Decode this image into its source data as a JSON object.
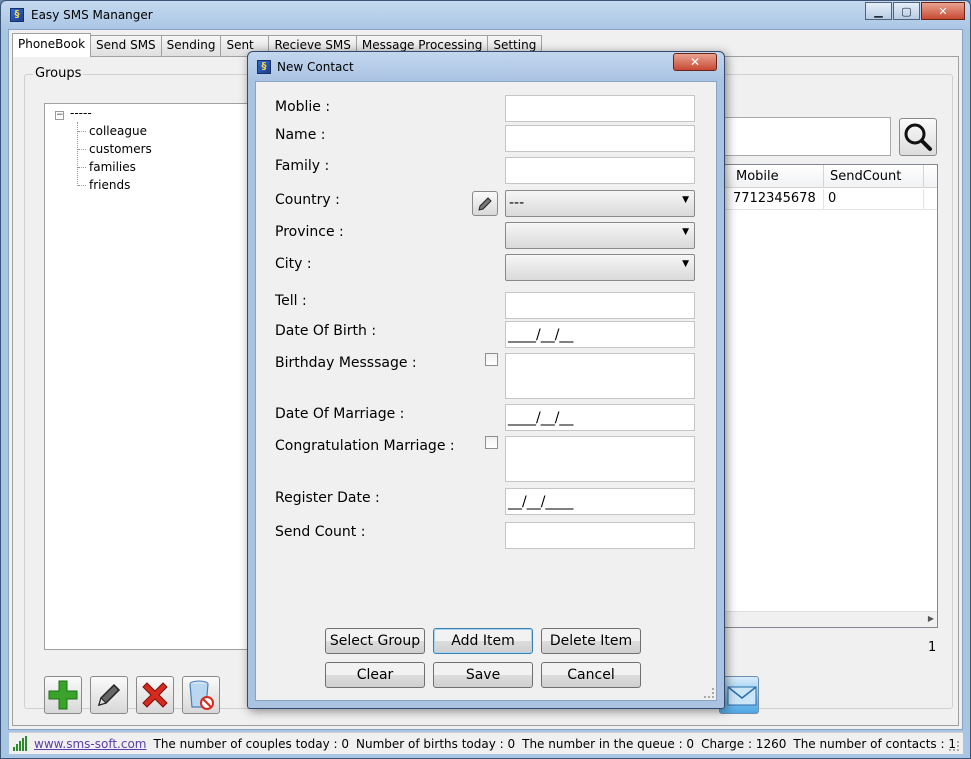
{
  "window": {
    "title": "Easy SMS Mananger",
    "minimize": "▁",
    "maximize": "▢",
    "close": "✕"
  },
  "tabs": [
    {
      "label": "PhoneBook"
    },
    {
      "label": "Send SMS"
    },
    {
      "label": "Sending"
    },
    {
      "label": "Sent"
    },
    {
      "label": "Recieve SMS"
    },
    {
      "label": "Message Processing"
    },
    {
      "label": "Setting"
    }
  ],
  "phonebook": {
    "groups_label": "Groups",
    "tree_root": "-----",
    "tree_expander": "−",
    "tree_children": [
      "colleague",
      "customers",
      "families",
      "friends"
    ],
    "grid": {
      "columns": [
        "Mobile",
        "SendCount"
      ],
      "rows": [
        [
          "7712345678",
          "0"
        ]
      ]
    },
    "page_number": "1"
  },
  "status_bar": {
    "link": "www.sms-soft.com",
    "items": [
      "The number of couples today : 0",
      "Number of births today : 0",
      "The number in the queue : 0",
      "Charge : 1260",
      "The number of contacts : 1"
    ]
  },
  "dialog": {
    "title": "New Contact",
    "close": "✕",
    "labels": {
      "mobile": "Moblie :",
      "name": "Name :",
      "family": "Family :",
      "country": "Country :",
      "province": "Province :",
      "city": "City :",
      "tell": "Tell :",
      "dob": "Date Of Birth :",
      "birthday_message": "Birthday Messsage :",
      "dom": "Date Of Marriage :",
      "congrat_marriage": "Congratulation Marriage :",
      "register_date": "Register Date :",
      "send_count": "Send Count :"
    },
    "values": {
      "mobile": "",
      "name": "",
      "family": "",
      "country": "---",
      "province": "",
      "city": "",
      "tell": "",
      "dob": "____/__/__",
      "dom": "____/__/__",
      "register_date": "__/__/____",
      "send_count": ""
    },
    "buttons": {
      "select_group": "Select Group",
      "add_item": "Add Item",
      "delete_item": "Delete Item",
      "clear": "Clear",
      "save": "Save",
      "cancel": "Cancel"
    }
  },
  "icons": {
    "app": "app-icon",
    "search": "search-icon",
    "add": "plus-icon",
    "edit": "pencil-icon",
    "delete": "x-icon",
    "recycle": "recycle-bin-icon",
    "send_mail": "envelope-icon",
    "signal": "signal-bars-icon"
  },
  "colors": {
    "title_bar": "#a9c5e4",
    "add_green": "#3aa329",
    "delete_red": "#d62a1e",
    "link": "#5a3ea8"
  }
}
